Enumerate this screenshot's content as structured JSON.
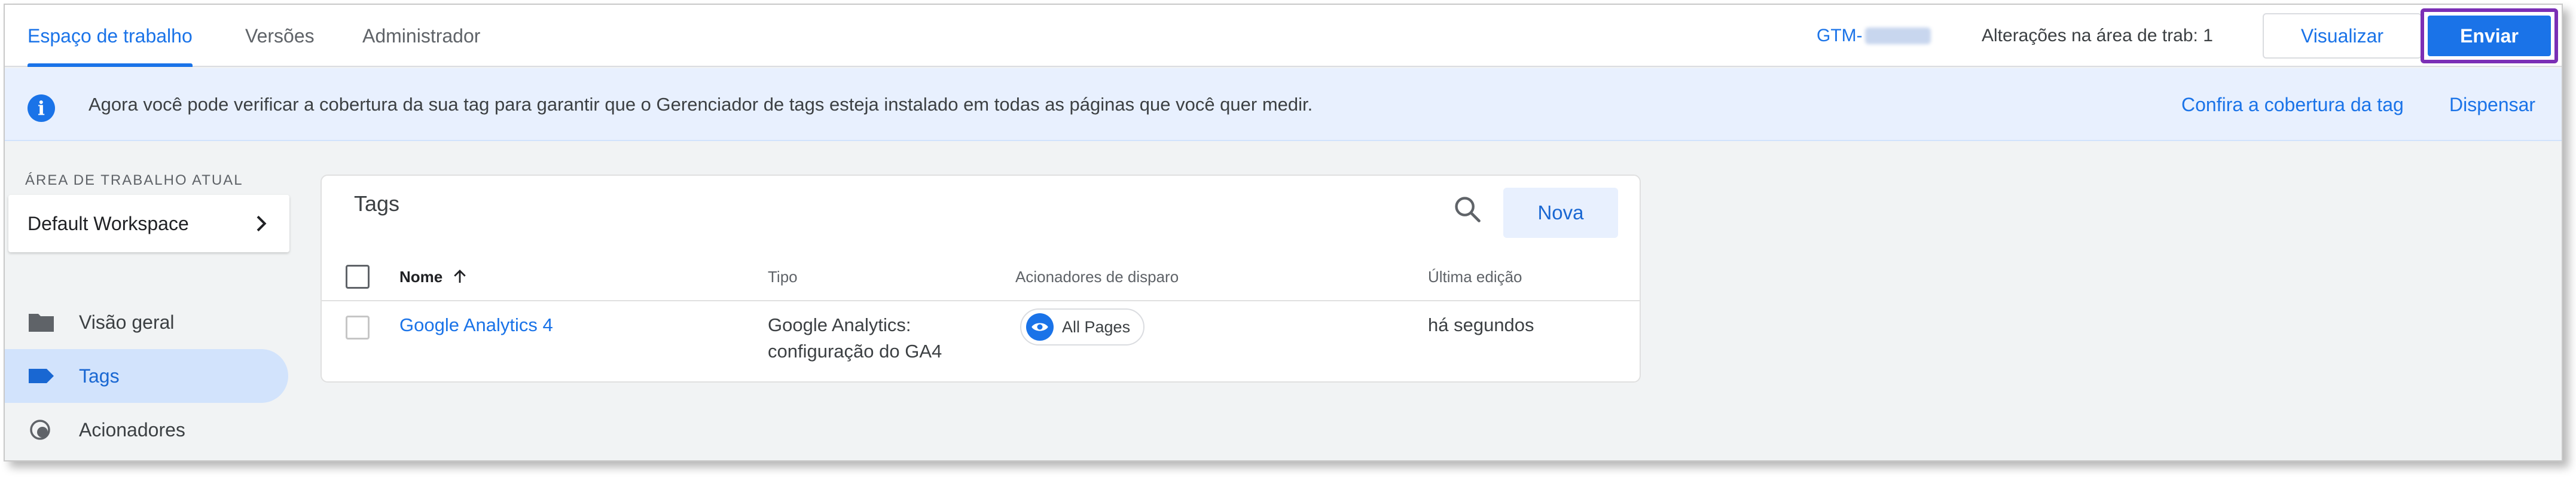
{
  "topbar": {
    "tabs": [
      {
        "label": "Espaço de trabalho",
        "active": true
      },
      {
        "label": "Versões",
        "active": false
      },
      {
        "label": "Administrador",
        "active": false
      }
    ],
    "container_id_prefix": "GTM-",
    "changes_text": "Alterações na área de trab: 1",
    "preview_label": "Visualizar",
    "submit_label": "Enviar"
  },
  "banner": {
    "icon": "info-icon",
    "message": "Agora você pode verificar a cobertura da sua tag para garantir que o Gerenciador de tags esteja instalado em todas as páginas que você quer medir.",
    "coverage_link": "Confira a cobertura da tag",
    "dismiss_link": "Dispensar"
  },
  "sidebar": {
    "workspace_label": "ÁREA DE TRABALHO ATUAL",
    "workspace_name": "Default Workspace",
    "items": [
      {
        "label": "Visão geral",
        "icon": "folder-icon",
        "active": false
      },
      {
        "label": "Tags",
        "icon": "tag-icon",
        "active": true
      },
      {
        "label": "Acionadores",
        "icon": "trigger-icon",
        "active": false
      }
    ]
  },
  "tags_card": {
    "title": "Tags",
    "new_label": "Nova",
    "columns": {
      "name": "Nome",
      "type": "Tipo",
      "triggers": "Acionadores de disparo",
      "last_edited": "Última edição"
    },
    "rows": [
      {
        "name": "Google Analytics 4",
        "type_line1": "Google Analytics:",
        "type_line2": "configuração do GA4",
        "trigger": "All Pages",
        "last_edited": "há segundos"
      }
    ]
  },
  "colors": {
    "accent": "#1a73e8",
    "active_nav_bg": "#d2e3fc",
    "banner_bg": "#e8f0fe",
    "submit_highlight": "#7b2fb5"
  }
}
